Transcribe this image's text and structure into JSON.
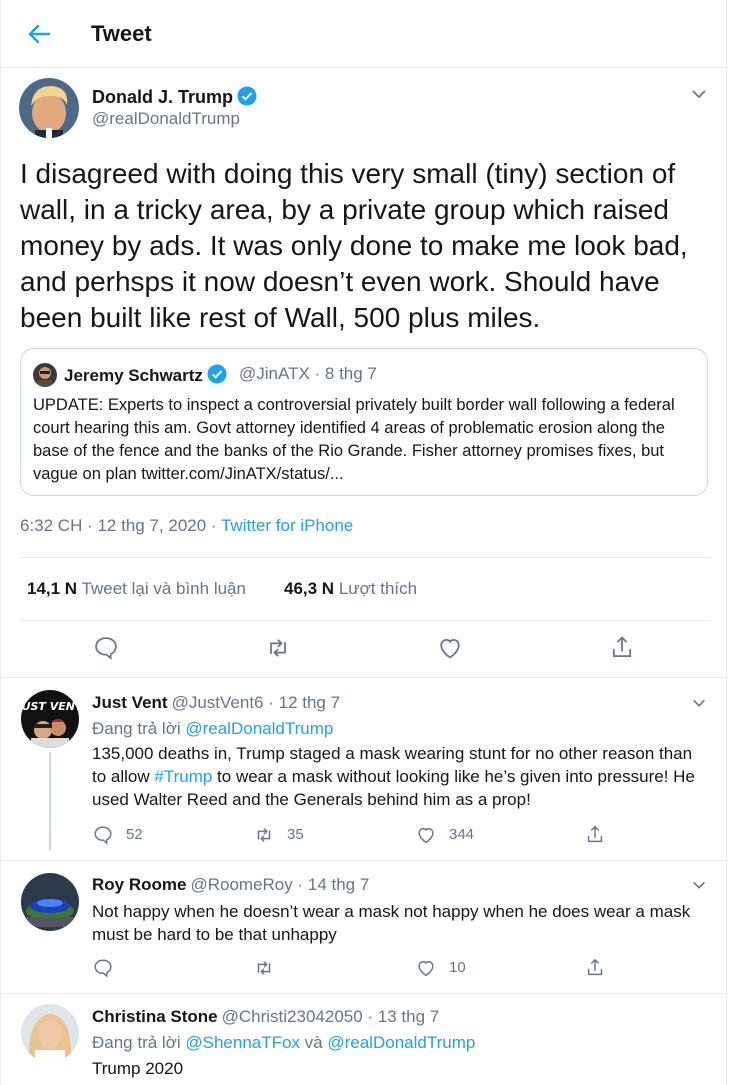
{
  "header": {
    "title": "Tweet"
  },
  "tweet": {
    "author_name": "Donald J. Trump",
    "author_handle": "@realDonaldTrump",
    "text": "I disagreed with doing this very small (tiny) section of wall, in a tricky area, by a private group which raised money by ads. It was only done to make me look bad, and perhsps it now doesn’t even work. Should have been built like rest of Wall, 500 plus miles.",
    "quote": {
      "author_name": "Jeremy Schwartz",
      "meta": "@JinATX · 8 thg 7",
      "text": "UPDATE: Experts to inspect a controversial privately built border wall following a federal court hearing this am. Govt attorney identified 4 areas of problematic erosion along the base of the fence and the banks of the Rio Grande. Fisher attorney promises fixes, but vague on plan twitter.com/JinATX/status/..."
    },
    "timestamp": "6:32 CH · 12 thg 7, 2020 · ",
    "source": "Twitter for iPhone",
    "retweets_count": "14,1 N",
    "retweets_label": "Tweet lại và bình luận",
    "likes_count": "46,3 N",
    "likes_label": "Lượt thích"
  },
  "replies": [
    {
      "name": "Just Vent",
      "meta": "@JustVent6 · 12 thg 7",
      "replying_prefix": "Đang trả lời ",
      "replying_to": "@realDonaldTrump",
      "replying_joiner": "",
      "replying_to2": "",
      "text_before": "135,000 deaths in, Trump staged a mask wearing stunt for no other reason than to allow ",
      "hashtag": "#Trump",
      "text_after": " to wear a mask without looking like he’s given into pressure! He used Walter Reed and the Generals behind him as a prop!",
      "reply_count": "52",
      "retweet_count": "35",
      "like_count": "344",
      "avatar_text": "JUST VENT"
    },
    {
      "name": "Roy Roome",
      "meta": "@RoomeRoy · 14 thg 7",
      "text": "Not happy when he doesn’t wear a mask not happy when he does wear a mask must be hard to be that unhappy",
      "reply_count": "",
      "retweet_count": "",
      "like_count": "10"
    },
    {
      "name": "Christina Stone",
      "meta": "@Christi23042050 · 13 thg 7",
      "replying_prefix": "Đang trả lời ",
      "replying_to": "@ShennaTFox",
      "replying_joiner": " và ",
      "replying_to2": "@realDonaldTrump",
      "text": "Trump 2020"
    }
  ],
  "colors": {
    "accent": "#1da1f2",
    "secondary_text": "#657786",
    "border": "#e6ecf0"
  }
}
